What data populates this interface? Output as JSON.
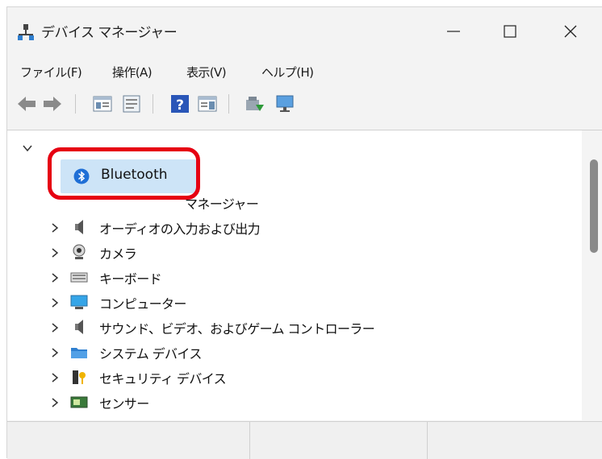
{
  "window": {
    "title": "デバイス マネージャー"
  },
  "menu": [
    "ファイル(F)",
    "操作(A)",
    "表示(V)",
    "ヘルプ(H)"
  ],
  "tree": {
    "root_partial": "",
    "bluetooth_label": "Bluetooth",
    "partial_row": "マネージャー",
    "items": [
      "オーディオの入力および出力",
      "カメラ",
      "キーボード",
      "コンピューター",
      "サウンド、ビデオ、およびゲーム コントローラー",
      "システム デバイス",
      "セキュリティ デバイス",
      "センサー"
    ]
  },
  "colors": {
    "highlight_ring": "#e60012",
    "selection": "#cde4f7",
    "bluetooth": "#1f6fd6"
  }
}
